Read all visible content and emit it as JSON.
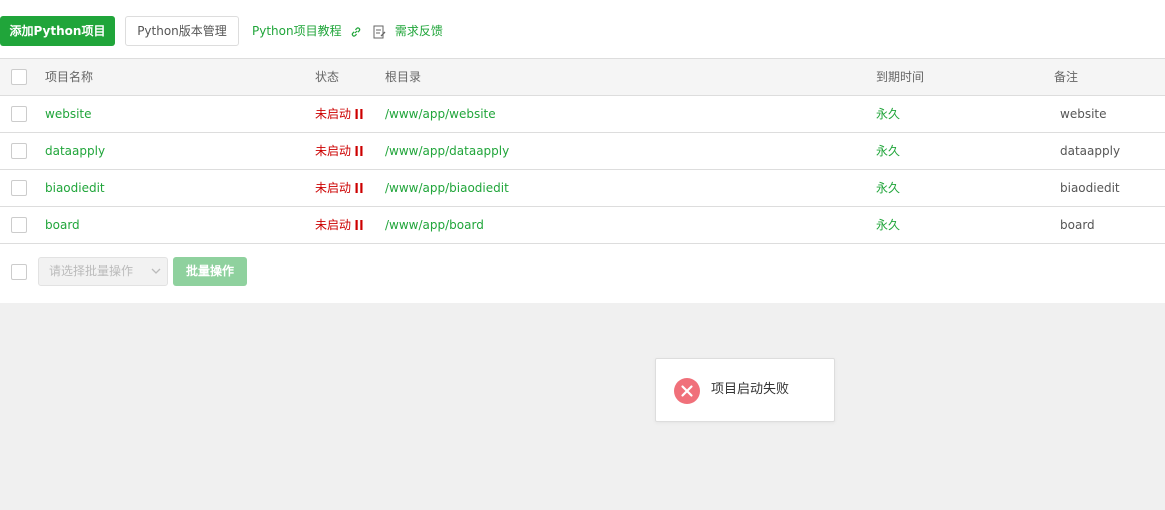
{
  "toolbar": {
    "add_label": "添加Python项目",
    "version_label": "Python版本管理",
    "tutorial_label": "Python项目教程",
    "feedback_label": "需求反馈"
  },
  "table": {
    "headers": {
      "name": "项目名称",
      "status": "状态",
      "root": "根目录",
      "expire": "到期时间",
      "note": "备注"
    },
    "rows": [
      {
        "name": "website",
        "status": "未启动",
        "root": "/www/app/website",
        "expire": "永久",
        "note": "website"
      },
      {
        "name": "dataapply",
        "status": "未启动",
        "root": "/www/app/dataapply",
        "expire": "永久",
        "note": "dataapply"
      },
      {
        "name": "biaodiedit",
        "status": "未启动",
        "root": "/www/app/biaodiedit",
        "expire": "永久",
        "note": "biaodiedit"
      },
      {
        "name": "board",
        "status": "未启动",
        "root": "/www/app/board",
        "expire": "永久",
        "note": "board"
      }
    ]
  },
  "footer": {
    "batch_select_placeholder": "请选择批量操作",
    "batch_button": "批量操作"
  },
  "toast": {
    "message": "项目启动失败",
    "icon": "error-x-icon"
  },
  "colors": {
    "accent": "#20a53a",
    "status_stopped": "#cc0000",
    "error": "#f0707a"
  }
}
